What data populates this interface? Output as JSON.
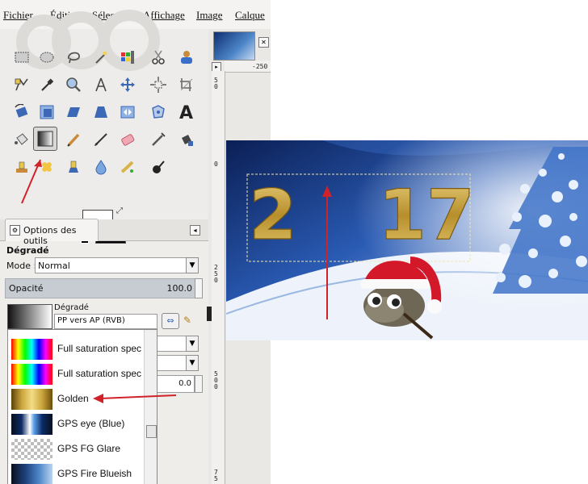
{
  "menu": [
    "Fichier",
    "Édition",
    "Sélection",
    "Affichage",
    "Image",
    "Calque"
  ],
  "tool_options": {
    "tab_label": "Options des outils",
    "tool_name": "Dégradé",
    "mode_label": "Mode :",
    "mode_value": "Normal",
    "opacity_label": "Opacité",
    "opacity_value": "100.0",
    "gradient_label": "Dégradé",
    "gradient_value": "PP vers AP (RVB)",
    "offset_value": "0.0"
  },
  "gradient_list": [
    {
      "label": "Full saturation spec",
      "icon": "rainbow-swatch"
    },
    {
      "label": "Full saturation spec",
      "icon": "rainbow-swatch"
    },
    {
      "label": "Golden",
      "icon": "golden-swatch"
    },
    {
      "label": "GPS eye (Blue)",
      "icon": "blue-eye-swatch"
    },
    {
      "label": "GPS FG Glare",
      "icon": "checker-glare-swatch"
    },
    {
      "label": "GPS Fire Blueish",
      "icon": "fire-blue-swatch"
    }
  ],
  "rulers": {
    "top": "-250",
    "left_marks": [
      "5",
      "0",
      "0",
      "2",
      "5",
      "0",
      "5",
      "0",
      "0",
      "7",
      "5"
    ]
  },
  "image": {
    "digits": "2  17"
  },
  "colors": {
    "annotation_red": "#d1222a",
    "golden": "#c9a43a",
    "sky_blue": "#2a5bb4"
  }
}
